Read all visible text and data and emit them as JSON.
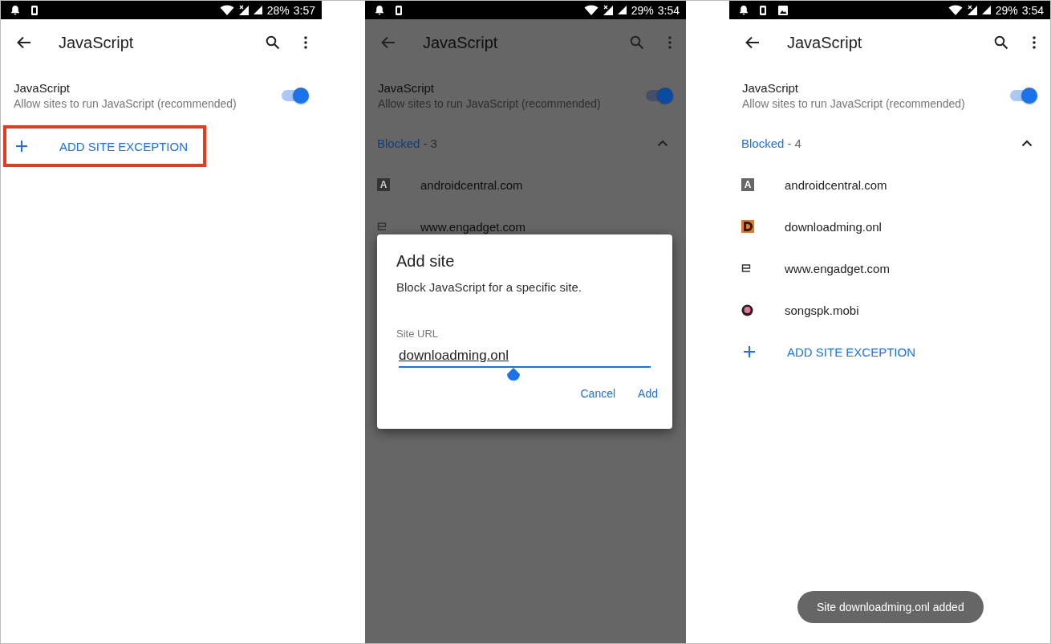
{
  "screens": [
    {
      "status_bar": {
        "notification_icons": [
          {
            "kind": "bell"
          },
          {
            "kind": "phone"
          }
        ],
        "battery": "28%",
        "time": "3:57"
      },
      "title": "JavaScript",
      "setting": {
        "title": "JavaScript",
        "subtitle": "Allow sites to run JavaScript (recommended)",
        "on": true
      },
      "add_exception": {
        "label": "ADD SITE EXCEPTION",
        "highlighted": true
      },
      "dimmed": false
    },
    {
      "status_bar": {
        "notification_icons": [
          {
            "kind": "bell"
          },
          {
            "kind": "phone"
          }
        ],
        "battery": "29%",
        "time": "3:54"
      },
      "title": "JavaScript",
      "setting": {
        "title": "JavaScript",
        "subtitle": "Allow sites to run JavaScript (recommended)",
        "on": true
      },
      "blocked": {
        "label": "Blocked",
        "count": "- 3",
        "expanded": true
      },
      "sites": [
        {
          "name": "androidcentral.com",
          "kind": "letter",
          "letter": "A"
        },
        {
          "name": "www.engadget.com",
          "kind": "engadget"
        }
      ],
      "dimmed": true,
      "dialog": {
        "title": "Add site",
        "message": "Block JavaScript for a specific site.",
        "field_label": "Site URL",
        "value": "downloadming.onl",
        "buttons": [
          "Cancel",
          "Add"
        ]
      }
    },
    {
      "status_bar": {
        "notification_icons": [
          {
            "kind": "bell"
          },
          {
            "kind": "phone"
          },
          {
            "kind": "image"
          }
        ],
        "battery": "29%",
        "time": "3:54"
      },
      "title": "JavaScript",
      "setting": {
        "title": "JavaScript",
        "subtitle": "Allow sites to run JavaScript (recommended)",
        "on": true
      },
      "blocked": {
        "label": "Blocked",
        "count": "- 4",
        "expanded": true
      },
      "sites": [
        {
          "name": "androidcentral.com",
          "kind": "letter",
          "letter": "A"
        },
        {
          "name": "downloadming.onl",
          "kind": "d-logo"
        },
        {
          "name": "www.engadget.com",
          "kind": "engadget"
        },
        {
          "name": "songspk.mobi",
          "kind": "disc"
        }
      ],
      "add_exception": {
        "label": "ADD SITE EXCEPTION",
        "highlighted": false
      },
      "dimmed": false,
      "toast": "Site downloadming.onl added"
    }
  ]
}
